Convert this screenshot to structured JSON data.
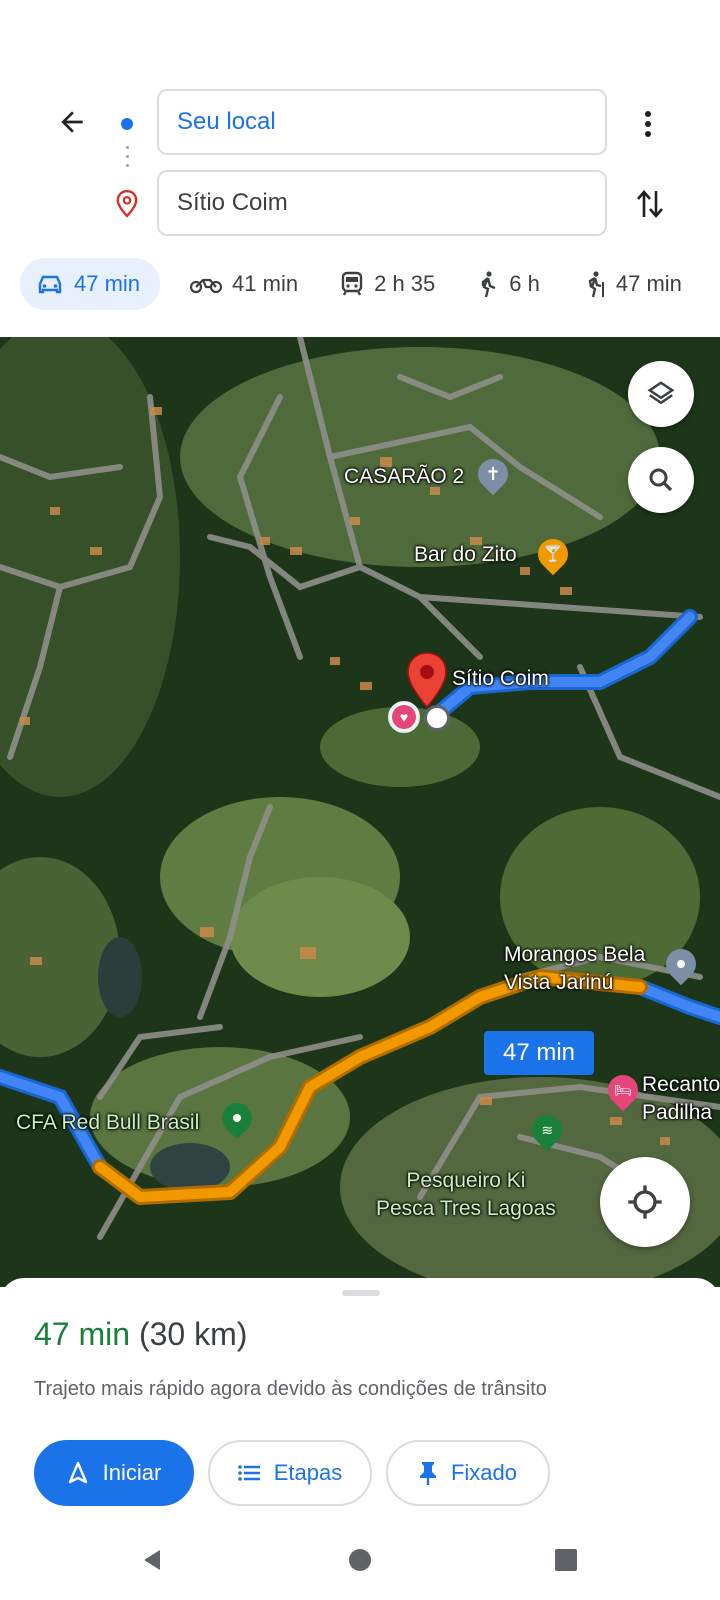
{
  "header": {
    "origin": "Seu local",
    "destination": "Sítio Coim"
  },
  "modes": [
    {
      "icon": "car-icon",
      "label": "47 min",
      "active": true
    },
    {
      "icon": "motorcycle-icon",
      "label": "41 min"
    },
    {
      "icon": "train-icon",
      "label": "2 h 35"
    },
    {
      "icon": "walk-icon",
      "label": "6 h"
    },
    {
      "icon": "hiking-icon",
      "label": "47 min"
    }
  ],
  "map": {
    "labels": {
      "casarao": "CASARÃO 2",
      "bar_zito": "Bar do Zito",
      "sitio": "Sítio Coim",
      "morangos": "Morangos Bela\nVista Jarinú",
      "recanto": "Recanto\nPadilha",
      "red_bull": "CFA Red Bull Brasil",
      "pesqueiro": "Pesqueiro Ki\nPesca Tres Lagoas"
    },
    "eta_badge": "47 min",
    "colors": {
      "route": "#4285f4",
      "traffic": "#f29900",
      "pin": "#ea4335"
    }
  },
  "sheet": {
    "time": "47 min",
    "distance": "(30 km)",
    "subtitle": "Trajeto mais rápido agora devido às condições de trânsito",
    "start_label": "Iniciar",
    "steps_label": "Etapas",
    "pinned_label": "Fixado"
  }
}
